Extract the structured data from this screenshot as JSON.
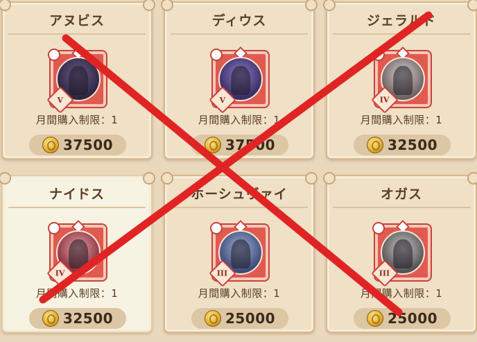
{
  "shop": {
    "items": [
      {
        "name": "アヌビス",
        "rank": "V",
        "limit": "月間購入制限：1",
        "price": "37500",
        "theme": "p1"
      },
      {
        "name": "ディウス",
        "rank": "V",
        "limit": "月間購入制限：1",
        "price": "37500",
        "theme": "p2"
      },
      {
        "name": "ジェラルド",
        "rank": "IV",
        "limit": "月間購入制限：1",
        "price": "32500",
        "theme": "p3"
      },
      {
        "name": "ナイドス",
        "rank": "IV",
        "limit": "月間購入制限：1",
        "price": "32500",
        "theme": "p4"
      },
      {
        "name": "ホーシュヴァイ",
        "rank": "III",
        "limit": "月間購入制限：1",
        "price": "25000",
        "theme": "p5"
      },
      {
        "name": "オガス",
        "rank": "III",
        "limit": "月間購入制限：1",
        "price": "25000",
        "theme": "p6"
      }
    ],
    "coin_icon": "gold-coin-icon",
    "overlay_icon": "red-cross-mark",
    "overlay_color": "#e02424"
  }
}
